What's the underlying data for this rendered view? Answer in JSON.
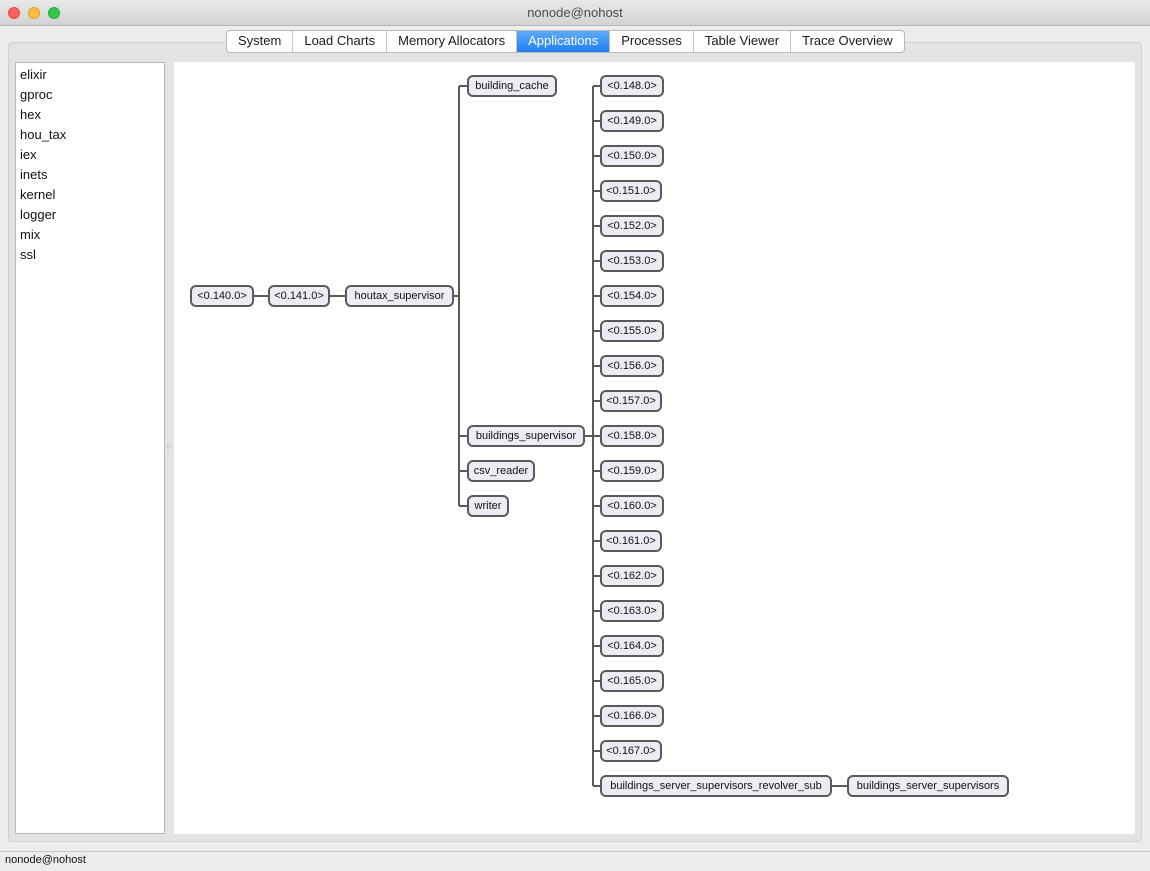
{
  "window": {
    "title": "nonode@nohost"
  },
  "tabs": [
    {
      "label": "System"
    },
    {
      "label": "Load Charts"
    },
    {
      "label": "Memory Allocators"
    },
    {
      "label": "Applications",
      "active": true
    },
    {
      "label": "Processes"
    },
    {
      "label": "Table Viewer"
    },
    {
      "label": "Trace Overview"
    }
  ],
  "applications": [
    "elixir",
    "gproc",
    "hex",
    "hou_tax",
    "iex",
    "inets",
    "kernel",
    "logger",
    "mix",
    "ssl"
  ],
  "tree": {
    "root": "<0.140.0>",
    "level1": "<0.141.0>",
    "supervisor": "houtax_supervisor",
    "children": [
      "building_cache",
      "buildings_supervisor",
      "csv_reader",
      "writer"
    ],
    "buildings_supervisor_children": [
      "<0.148.0>",
      "<0.149.0>",
      "<0.150.0>",
      "<0.151.0>",
      "<0.152.0>",
      "<0.153.0>",
      "<0.154.0>",
      "<0.155.0>",
      "<0.156.0>",
      "<0.157.0>",
      "<0.158.0>",
      "<0.159.0>",
      "<0.160.0>",
      "<0.161.0>",
      "<0.162.0>",
      "<0.163.0>",
      "<0.164.0>",
      "<0.165.0>",
      "<0.166.0>",
      "<0.167.0>",
      "buildings_server_supervisors_revolver_sub"
    ],
    "revolver_child": "buildings_server_supervisors"
  },
  "status": {
    "text": "nonode@nohost"
  },
  "colors": {
    "accent": "#1f7ff1",
    "node_fill": "#ececf5",
    "node_border": "#5a5a5a"
  }
}
